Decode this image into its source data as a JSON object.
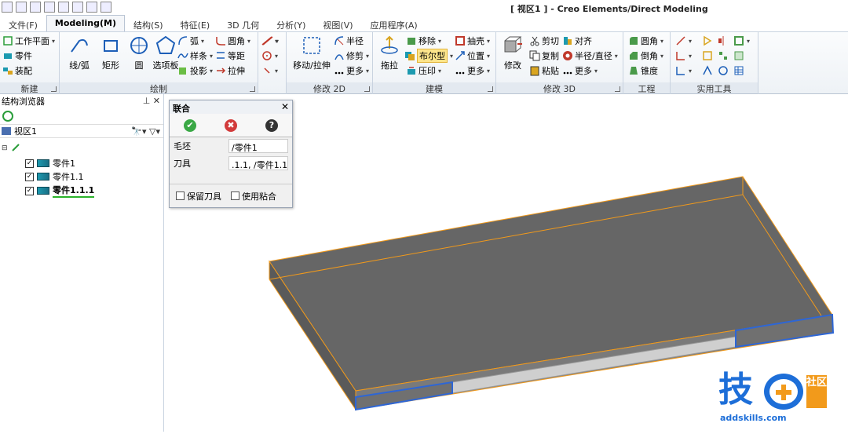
{
  "window": {
    "title": "[ 视区1 ] - Creo Elements/Direct Modeling"
  },
  "tabs": [
    "文件(F)",
    "Modeling(M)",
    "结构(S)",
    "特征(E)",
    "3D 几何",
    "分析(Y)",
    "视图(V)",
    "应用程序(A)"
  ],
  "active_tab_index": 1,
  "ribbon": {
    "new_group": {
      "label": "新建",
      "items": [
        "工作平面",
        "零件",
        "装配"
      ]
    },
    "draw_group": {
      "label": "绘制",
      "big": [
        "线/弧",
        "矩形",
        "圆",
        "选项板"
      ],
      "small": [
        "弧",
        "样条",
        "投影",
        "圆角",
        "等距",
        "拉伸"
      ]
    },
    "modify2d_group": {
      "label": "修改 2D",
      "big": "移动/拉伸",
      "small": [
        "半径",
        "修剪",
        "更多"
      ]
    },
    "model_group": {
      "label": "建模",
      "big": "拖拉",
      "small": [
        "移除",
        "布尔型",
        "压印",
        "抽壳",
        "位置",
        "更多"
      ],
      "highlighted": "布尔型"
    },
    "modify3d_group": {
      "label": "修改 3D",
      "big": "修改",
      "small": [
        "剪切",
        "复制",
        "粘贴",
        "对齐",
        "半径/直径",
        "更多"
      ]
    },
    "engineering_group": {
      "label": "工程",
      "small": [
        "圆角",
        "倒角",
        "锥度"
      ]
    },
    "utility_group": {
      "label": "实用工具"
    }
  },
  "browser": {
    "title": "结构浏览器",
    "view": "视区1",
    "items": [
      {
        "label": "零件1",
        "checked": true,
        "bold": false
      },
      {
        "label": "零件1.1",
        "checked": true,
        "bold": false
      },
      {
        "label": "零件1.1.1",
        "checked": true,
        "bold": true
      }
    ]
  },
  "dialog": {
    "title": "联合",
    "blank_label": "毛坯",
    "blank_value": "/零件1",
    "tool_label": "刀具",
    "tool_value": ".1.1, /零件1.1",
    "keep_tool_label": "保留刀具",
    "use_glue_label": "使用粘合",
    "ok_color": "#3aa845",
    "cancel_color": "#d23b3b",
    "help_color": "#333333"
  },
  "logo": {
    "main": "技",
    "side": "社区",
    "url": "addskills.com"
  }
}
